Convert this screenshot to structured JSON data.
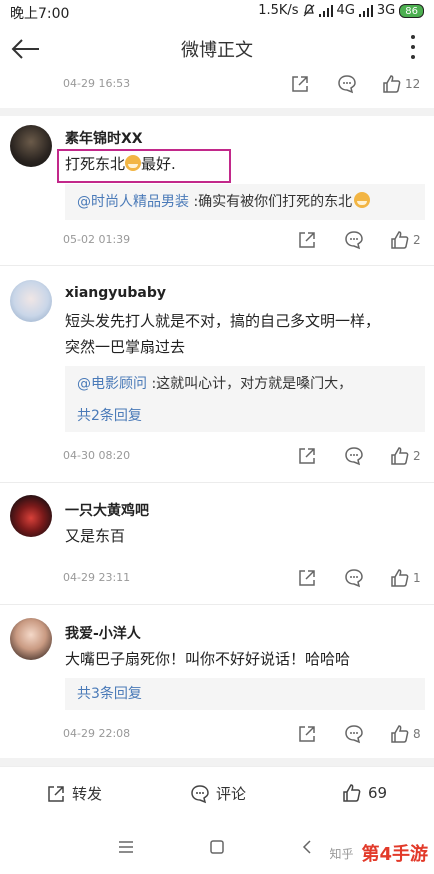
{
  "status_bar": {
    "time": "晚上7:00",
    "speed": "1.5K/s",
    "net1": "4G",
    "net2": "3G",
    "battery": "86"
  },
  "header": {
    "title": "微博正文"
  },
  "top_meta": {
    "date": "04-29 16:53",
    "likes": "12"
  },
  "comments": [
    {
      "user": "素年锦时XX",
      "text_before": "打死东北",
      "text_after": "最好.",
      "quote_mention": "@时尚人精品男装",
      "quote_text": " :确实有被你们打死的东北",
      "date": "05-02 01:39",
      "likes": "2"
    },
    {
      "user": "xiangyubaby",
      "line1": "短头发先打人就是不对，搞的自己多文明一样，",
      "line2": "突然一巴掌扇过去",
      "quote_mention": "@电影顾问",
      "quote_text": " :这就叫心计，对方就是嗓门大，",
      "replies": "共2条回复",
      "date": "04-30 08:20",
      "likes": "2"
    },
    {
      "user": "一只大黄鸡吧",
      "text": "又是东百",
      "date": "04-29 23:11",
      "likes": "1"
    },
    {
      "user": "我爱-小洋人",
      "text": "大嘴巴子扇死你！叫你不好好说话！哈哈哈",
      "replies": "共3条回复",
      "date": "04-29 22:08",
      "likes": "8"
    }
  ],
  "bottom_bar": {
    "repost": "转发",
    "comment": "评论",
    "likes": "69"
  },
  "watermark": {
    "small": "知乎",
    "brand": "第4手游"
  },
  "colors": {
    "link": "#4a7ab8",
    "highlight_border": "#c2288a"
  }
}
